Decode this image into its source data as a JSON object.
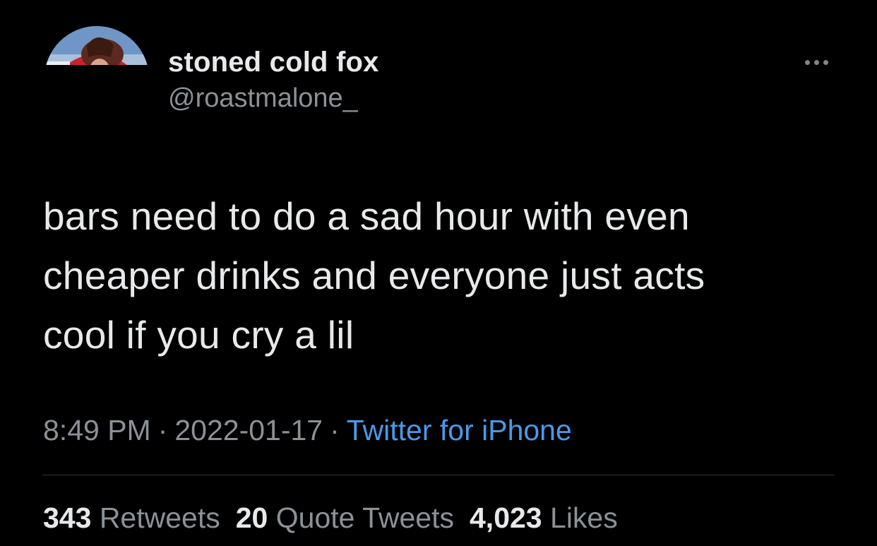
{
  "author": {
    "display_name": "stoned cold fox",
    "handle": "@roastmalone_"
  },
  "tweet": {
    "text": "bars need to do a sad hour with even\ncheaper drinks and everyone just acts\ncool if you cry a lil",
    "time": "8:49 PM",
    "date": "2022-01-17",
    "separator": "·",
    "source": "Twitter for iPhone"
  },
  "stats": {
    "retweets": {
      "count": "343",
      "label": "Retweets"
    },
    "quote_tweets": {
      "count": "20",
      "label": "Quote Tweets"
    },
    "likes": {
      "count": "4,023",
      "label": "Likes"
    }
  },
  "icons": {
    "more": "more-horizontal-icon"
  },
  "colors": {
    "background": "#000000",
    "primary_text": "#e7e9ea",
    "secondary_text": "#8b9196",
    "link": "#4a99e9",
    "divider": "#2f3336"
  }
}
